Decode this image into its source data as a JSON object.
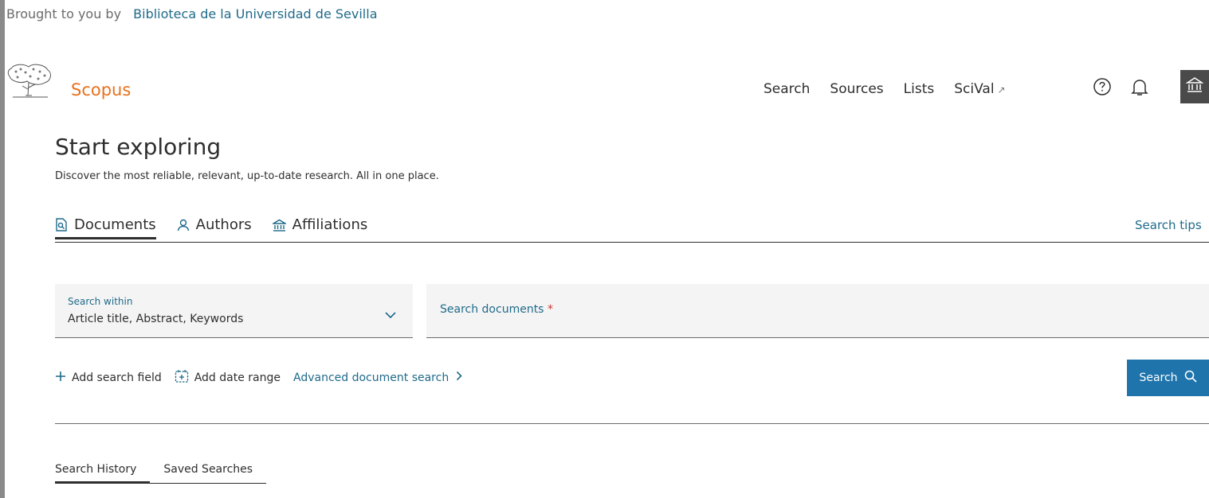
{
  "banner": {
    "prefix": "Brought to you by",
    "institution": "Biblioteca de la Universidad de Sevilla"
  },
  "brand": {
    "name": "Scopus",
    "color": "#e9711c"
  },
  "topnav": [
    {
      "label": "Search"
    },
    {
      "label": "Sources"
    },
    {
      "label": "Lists"
    },
    {
      "label": "SciVal",
      "icon": "external-arrow-icon",
      "icon_glyph": "↗"
    }
  ],
  "hero": {
    "title": "Start exploring",
    "subtitle": "Discover the most reliable, relevant, up-to-date research. All in one place."
  },
  "tabs": [
    {
      "label": "Documents",
      "icon": "document-search-icon",
      "active": true
    },
    {
      "label": "Authors",
      "icon": "person-icon",
      "active": false
    },
    {
      "label": "Affiliations",
      "icon": "institution-icon",
      "active": false
    }
  ],
  "search_tips": {
    "label": "Search tips"
  },
  "search_within": {
    "label": "Search within",
    "value": "Article title, Abstract, Keywords"
  },
  "search_documents": {
    "placeholder": "Search documents",
    "required_mark": "*"
  },
  "actions": {
    "add_field": "Add search field",
    "add_date": "Add date range",
    "advanced": "Advanced document search"
  },
  "search_button": {
    "label": "Search"
  },
  "history_tabs": [
    {
      "label": "Search History",
      "active": true
    },
    {
      "label": "Saved Searches",
      "active": false
    }
  ],
  "colors": {
    "link": "#1f6a8a",
    "primary_button": "#1f74ac",
    "text": "#2e2e2e",
    "required": "#c83737"
  }
}
